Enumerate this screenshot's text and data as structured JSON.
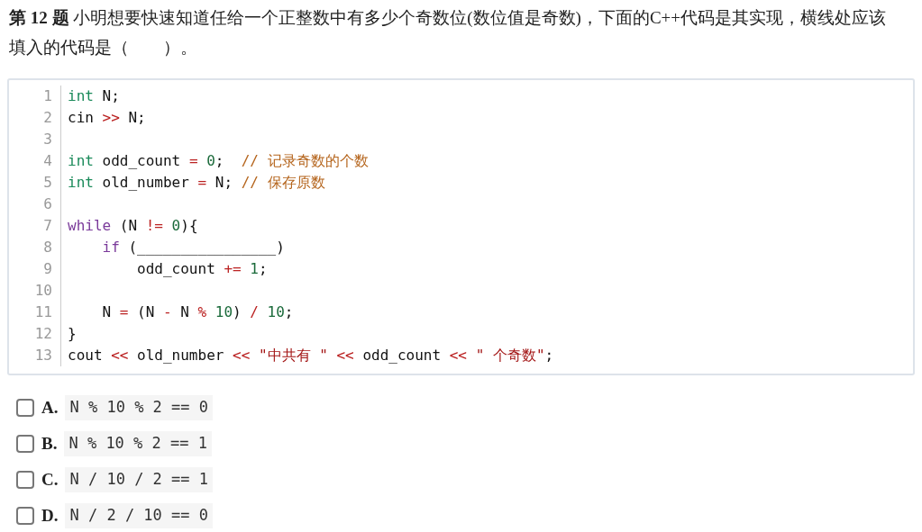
{
  "question": {
    "text": "**第 12 题** 小明想要快速知道任给一个正整数中有多少个奇数位(数位值是奇数)，下面的C++代码是其实现，横线处应该填入的代码是（　　）。"
  },
  "code": {
    "lines": [
      {
        "number": "1",
        "tokens": [
          {
            "kind": "type",
            "text": "int"
          },
          {
            "kind": "plain",
            "text": " N;"
          }
        ]
      },
      {
        "number": "2",
        "tokens": [
          {
            "kind": "plain",
            "text": "cin "
          },
          {
            "kind": "op",
            "text": ">>"
          },
          {
            "kind": "plain",
            "text": " N;"
          }
        ]
      },
      {
        "number": "3"
      },
      {
        "number": "4",
        "tokens": [
          {
            "kind": "type",
            "text": "int"
          },
          {
            "kind": "plain",
            "text": " odd_count "
          },
          {
            "kind": "op",
            "text": "= "
          },
          {
            "kind": "number",
            "text": "0"
          },
          {
            "kind": "plain",
            "text": ";  "
          },
          {
            "kind": "comment",
            "text": "// 记录奇数的个数"
          }
        ]
      },
      {
        "number": "5",
        "tokens": [
          {
            "kind": "type",
            "text": "int"
          },
          {
            "kind": "plain",
            "text": " old_number "
          },
          {
            "kind": "op",
            "text": "="
          },
          {
            "kind": "plain",
            "text": " N; "
          },
          {
            "kind": "comment",
            "text": "// 保存原数"
          }
        ]
      },
      {
        "number": "6"
      },
      {
        "number": "7",
        "tokens": [
          {
            "kind": "keyword",
            "text": "while"
          },
          {
            "kind": "plain",
            "text": " (N "
          },
          {
            "kind": "op",
            "text": "!= "
          },
          {
            "kind": "number",
            "text": "0"
          },
          {
            "kind": "plain",
            "text": "){"
          }
        ]
      },
      {
        "number": "8",
        "tokens": [
          {
            "kind": "keyword",
            "text": "    if"
          },
          {
            "kind": "plain",
            "text": " (________________)"
          }
        ]
      },
      {
        "number": "9",
        "tokens": [
          {
            "kind": "plain",
            "text": "        odd_count "
          },
          {
            "kind": "op",
            "text": "+= "
          },
          {
            "kind": "number",
            "text": "1"
          },
          {
            "kind": "plain",
            "text": ";"
          }
        ]
      },
      {
        "number": "10"
      },
      {
        "number": "11",
        "tokens": [
          {
            "kind": "plain",
            "text": "    N "
          },
          {
            "kind": "op",
            "text": "="
          },
          {
            "kind": "plain",
            "text": " (N "
          },
          {
            "kind": "op",
            "text": "-"
          },
          {
            "kind": "plain",
            "text": " N "
          },
          {
            "kind": "op",
            "text": "% "
          },
          {
            "kind": "number",
            "text": "10"
          },
          {
            "kind": "plain",
            "text": ") "
          },
          {
            "kind": "op",
            "text": "/ "
          },
          {
            "kind": "number",
            "text": "10"
          },
          {
            "kind": "plain",
            "text": ";"
          }
        ]
      },
      {
        "number": "12",
        "tokens": [
          {
            "kind": "plain",
            "text": "}"
          }
        ]
      },
      {
        "number": "13",
        "tokens": [
          {
            "kind": "plain",
            "text": "cout "
          },
          {
            "kind": "op",
            "text": "<<"
          },
          {
            "kind": "plain",
            "text": " old_number "
          },
          {
            "kind": "op",
            "text": "<< "
          },
          {
            "kind": "string",
            "text": "\"中共有 \""
          },
          {
            "kind": "op",
            "text": " <<"
          },
          {
            "kind": "plain",
            "text": " odd_count "
          },
          {
            "kind": "op",
            "text": "<< "
          },
          {
            "kind": "string",
            "text": "\" 个奇数\""
          },
          {
            "kind": "plain",
            "text": ";"
          }
        ]
      }
    ]
  },
  "options": [
    {
      "letter": "A.",
      "code": "N % 10 % 2 == 0",
      "checked": false
    },
    {
      "letter": "B.",
      "code": "N % 10 % 2 == 1",
      "checked": false
    },
    {
      "letter": "C.",
      "code": "N / 10 / 2 == 1",
      "checked": false
    },
    {
      "letter": "D.",
      "code": "N / 2 / 10 == 0",
      "checked": false
    }
  ]
}
